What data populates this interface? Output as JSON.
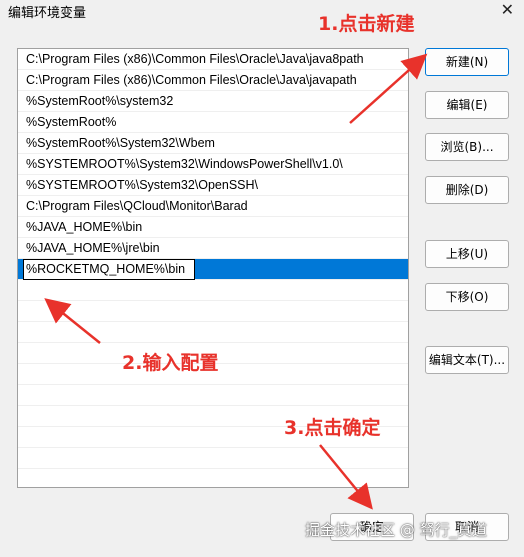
{
  "window": {
    "title": "编辑环境变量",
    "close": "✕"
  },
  "path_list": {
    "items": [
      "C:\\Program Files (x86)\\Common Files\\Oracle\\Java\\java8path",
      "C:\\Program Files (x86)\\Common Files\\Oracle\\Java\\javapath",
      "%SystemRoot%\\system32",
      "%SystemRoot%",
      "%SystemRoot%\\System32\\Wbem",
      "%SYSTEMROOT%\\System32\\WindowsPowerShell\\v1.0\\",
      "%SYSTEMROOT%\\System32\\OpenSSH\\",
      "C:\\Program Files\\QCloud\\Monitor\\Barad",
      "%JAVA_HOME%\\bin",
      "%JAVA_HOME%\\jre\\bin"
    ],
    "editing_value": "%ROCKETMQ_HOME%\\bin"
  },
  "buttons": {
    "new": "新建(N)",
    "edit": "编辑(E)",
    "browse": "浏览(B)...",
    "delete": "删除(D)",
    "move_up": "上移(U)",
    "move_down": "下移(O)",
    "edit_text": "编辑文本(T)...",
    "ok": "确定",
    "cancel": "取消"
  },
  "annotations": {
    "step1": "1.点击新建",
    "step2": "2.输入配置",
    "step3": "3.点击确定"
  },
  "watermark": "掘金技术社区 @ 驽行_真道",
  "colors": {
    "annotation": "#e8322b",
    "selection": "#0078d7"
  }
}
